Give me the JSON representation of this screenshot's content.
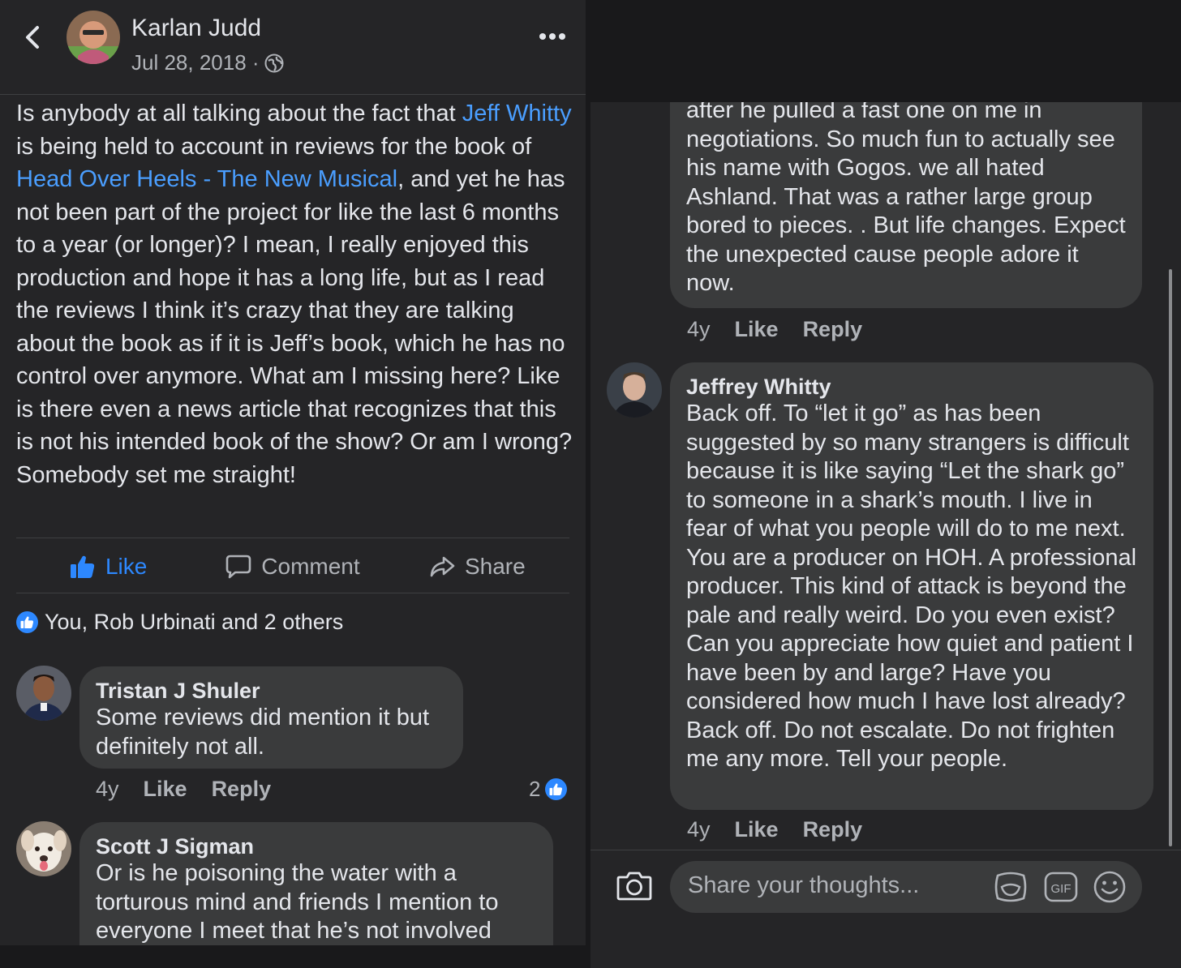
{
  "header": {
    "author": "Karlan Judd",
    "date": "Jul 28, 2018 ·"
  },
  "post": {
    "segments": [
      {
        "text": "Is anybody at all talking about the fact that ",
        "link": false
      },
      {
        "text": "Jeff Whitty",
        "link": true
      },
      {
        "text": " is being held to account in reviews for the book of ",
        "link": false
      },
      {
        "text": "Head Over Heels - The New Musical",
        "link": true
      },
      {
        "text": ", and yet he has not been part of the project for like the last 6 months to a year (or longer)? I mean, I really enjoyed this production and hope it has a long life, but as I read the reviews I think it’s crazy that they are talking about the book as if it is Jeff’s book, which he has no control over anymore. What am I missing here? Like is there even a news article that recognizes that this is not his intended book of the show? Or am I wrong? Somebody set me straight!",
        "link": false
      }
    ]
  },
  "actions": {
    "like": "Like",
    "comment": "Comment",
    "share": "Share"
  },
  "reactions": {
    "summary": "You, Rob Urbinati and 2 others"
  },
  "comments_left": [
    {
      "name": "Tristan J Shuler",
      "text": "Some reviews did mention it but definitely not all.",
      "age": "4y",
      "like": "Like",
      "reply": "Reply",
      "reaction_count": "2"
    },
    {
      "name": "Scott J Sigman",
      "text": "Or is he poisoning the water with a torturous mind and friends   I mention to everyone I meet that he’s not involved"
    }
  ],
  "comments_right": [
    {
      "text": "after he pulled a fast one on me in negotiations.  So much fun to actually see his name with Gogos. we all hated Ashland. That was a rather large group bored to pieces. .   But life changes. Expect the unexpected cause people adore it now.",
      "age": "4y",
      "like": "Like",
      "reply": "Reply"
    },
    {
      "name": "Jeffrey Whitty",
      "text": "Back off. To “let it go” as has been suggested by so many strangers is difficult because it is like saying “Let the shark go” to someone in a shark’s mouth. I live in fear of what you people will do to me next. You are a producer on HOH. A professional producer. This kind of attack is beyond the pale and really weird. Do you even exist? Can you appreciate how quiet and patient I have been by and large? Have you considered how much I have lost already? Back off. Do not escalate. Do not frighten me any more. Tell your people.",
      "age": "4y",
      "like": "Like",
      "reply": "Reply"
    }
  ],
  "composer": {
    "placeholder": "Share your thoughts...",
    "gif_label": "GIF"
  },
  "colors": {
    "panel_bg": "#252527",
    "bubble_bg": "#3a3b3c",
    "link": "#4a9eff",
    "like_blue": "#2d88ff",
    "secondary_text": "#b0b3b8"
  },
  "icons": [
    "back-chevron-icon",
    "globe-icon",
    "more-dots-icon",
    "thumbs-up-icon",
    "comment-icon",
    "share-icon",
    "camera-icon",
    "sticker-icon",
    "gif-icon",
    "emoji-icon"
  ]
}
